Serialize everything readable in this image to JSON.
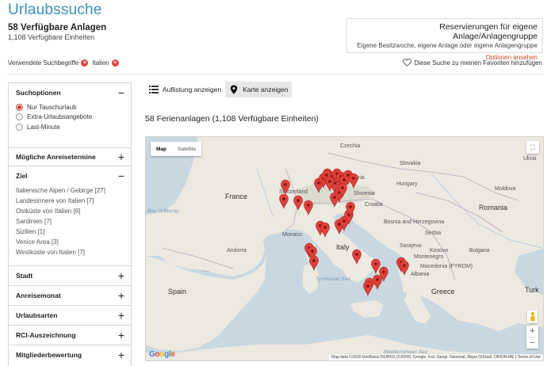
{
  "page": {
    "title": "Urlaubssuche",
    "result_count": "58 Verfügbare Anlagen",
    "unit_count": "1,108 Verfügbare Einheiten"
  },
  "promo": {
    "title": "Reservierungen für eigene Anlage/Anlagengruppe",
    "subtitle": "Eigene Besitzwoche, eigene Anlage oder eigene Anlagengruppe",
    "link": "Optionen ansehen"
  },
  "search_terms": {
    "label": "Verwendete Suchbegriffe",
    "terms": [
      "Italien"
    ],
    "favorite_link": "Diese Suche zu meinen Favoriten hinzufügen"
  },
  "sidebar": {
    "options": {
      "title": "Suchoptionen",
      "radios": [
        {
          "label": "Nur Tauschurlaub",
          "selected": true
        },
        {
          "label": "Extra-Urlaubsangebote",
          "selected": false
        },
        {
          "label": "Last-Minute",
          "selected": false
        }
      ]
    },
    "arrival": {
      "title": "Mögliche Anreisetermine"
    },
    "destination": {
      "title": "Ziel",
      "items": [
        "Italienische Alpen / Gebirge  [27]",
        "Landesinnere von Italien  [7]",
        "Ostküste von Italien  [6]",
        "Sardinien  [7]",
        "Sizilien  [1]",
        "Venice Area  [3]",
        "Westküste von Italien  [7]"
      ]
    },
    "city": {
      "title": "Stadt"
    },
    "month": {
      "title": "Anreisemonat"
    },
    "types": {
      "title": "Urlaubsarten"
    },
    "award": {
      "title": "RCI-Auszeichnung"
    },
    "rating": {
      "title": "Mitgliederbewertung"
    }
  },
  "view": {
    "list_label": "Auflistung anzeigen",
    "map_label": "Karte anzeigen"
  },
  "map_section": {
    "title": "58 Ferienanlagen (1,108 Verfügbare Einheiten)"
  },
  "map": {
    "type_map": "Map",
    "type_satellite": "Satellite",
    "zoom_in": "+",
    "zoom_out": "−",
    "google": "Google",
    "attribution": "Map data ©2018 GeoBasis-DE/BKG (©2009), Google, Inst. Geogr. Nacional, Mapa GISrael, ORION-ME  |  Terms of Use",
    "labels": {
      "czech": "Czechia",
      "slovakia": "Slovakia",
      "ukraine": "Ukrai",
      "austria": "Austria",
      "hungary": "Hungary",
      "moldova": "Moldova",
      "france": "France",
      "switzerland": "Switzerland",
      "slovenia": "Slovenia",
      "croatia": "Croatia",
      "romania": "Romania",
      "bosnia": "Bosnia and Herzegovina",
      "serbia": "Serbia",
      "monaco": "Monaco",
      "montenegro": "Montenegro",
      "bulgaria": "Bulgaria",
      "kosovo": "Kosovo",
      "andorra": "Andorra",
      "italy": "Italy",
      "macedonia": "Macedonia (FYROM)",
      "albania": "Albania",
      "spain": "Spain",
      "greece": "Greece",
      "biscay": "Bay of Biscay",
      "tyrrhenian": "Tyrrhenian Sea",
      "mediterranean": "Mediterranean Sea",
      "turkey": "Turk",
      "sarajevo": "Sarajevo"
    }
  }
}
